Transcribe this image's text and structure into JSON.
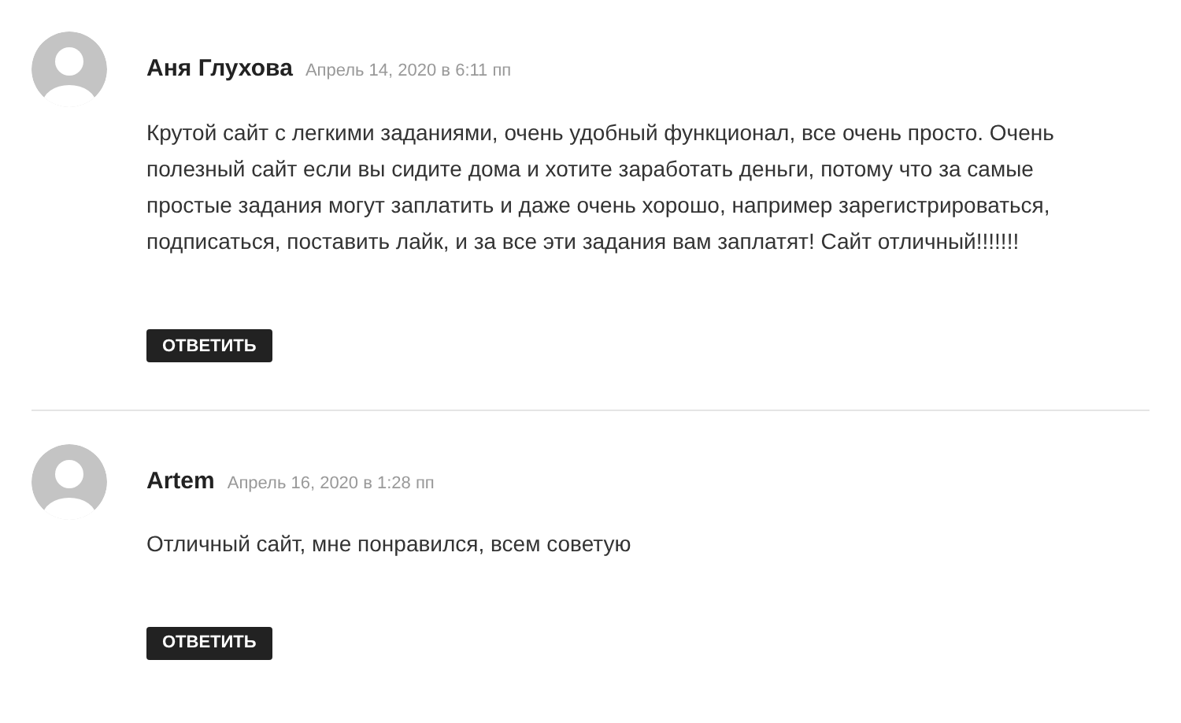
{
  "comments": [
    {
      "author": "Аня Глухова",
      "date": "Апрель 14, 2020 в 6:11 пп",
      "text": "Крутой сайт с легкими заданиями, очень удобный функционал, все очень просто. Очень полезный сайт если вы сидите дома и хотите заработать деньги, потому что за самые простые задания могут заплатить и даже очень хорошо, например зарегистрироваться, подписаться, поставить лайк, и за все эти задания вам заплатят! Сайт отличный!!!!!!!",
      "reply": "ОТВЕТИТЬ"
    },
    {
      "author": "Artem",
      "date": "Апрель 16, 2020 в 1:28 пп",
      "text": "Отличный сайт, мне понравился, всем советую",
      "reply": "ОТВЕТИТЬ"
    }
  ]
}
